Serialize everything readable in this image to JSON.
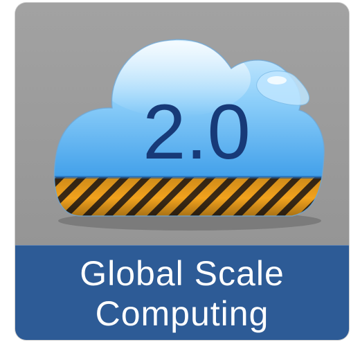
{
  "badge": {
    "version": "2.0",
    "caption_line1": "Global Scale",
    "caption_line2": "Computing",
    "icon": "cloud-icon",
    "colors": {
      "background": "#9a9a9a",
      "caption_band": "#2d5b96",
      "caption_text": "#ffffff",
      "version_text": "#173a78",
      "stripe_orange": "#f2a21d",
      "stripe_dark": "#3b2a16"
    }
  }
}
